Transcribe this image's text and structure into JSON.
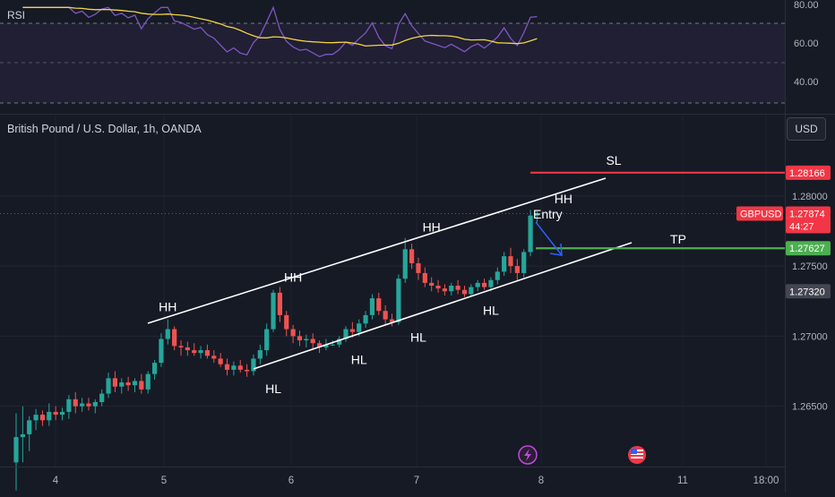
{
  "rsi": {
    "label": "RSI",
    "levels": [
      80,
      60,
      40
    ],
    "tick_labels": [
      "80.00",
      "60.00",
      "40.00"
    ],
    "upper_band": 70,
    "lower_band": 30,
    "colors": {
      "rsi": "#7e57c2",
      "ma": "#f5d442",
      "band_fill": "#2a2540"
    }
  },
  "main": {
    "title": "British Pound / U.S. Dollar, 1h, OANDA",
    "currency_button": "USD"
  },
  "chart_data": {
    "type": "candlestick",
    "symbol": "GBPUSD",
    "x_tick_labels": [
      "4",
      "5",
      "6",
      "7",
      "8",
      "11",
      "18:00"
    ],
    "y_tick_labels": [
      "1.28000",
      "1.27500",
      "1.27000",
      "1.26500"
    ],
    "y_ticks": [
      1.28,
      1.275,
      1.27,
      1.265
    ],
    "ylim": [
      1.2607,
      1.2858
    ],
    "price_tags": [
      {
        "label": "1.28166",
        "value": 1.28166,
        "color": "#f23645"
      },
      {
        "label": "GBPUSD",
        "value": 1.27874,
        "color": "#f23645"
      },
      {
        "label": "1.27874",
        "value": 1.27874,
        "color": "#f23645"
      },
      {
        "label": "44:27",
        "value": 1.27874,
        "color": "#f23645"
      },
      {
        "label": "1.27627",
        "value": 1.27627,
        "color": "#4caf50"
      },
      {
        "label": "1.27320",
        "value": 1.2732,
        "color": "#434651"
      }
    ],
    "annotations": {
      "sl": {
        "label": "SL",
        "value": 1.28166,
        "color": "#f23645"
      },
      "tp": {
        "label": "TP",
        "value": 1.27627,
        "color": "#4caf50"
      },
      "entry": {
        "label": "Entry",
        "color": "#2962ff"
      },
      "swing_labels": [
        {
          "label": "HH",
          "bar": 23,
          "price": 1.2712,
          "pos": "above"
        },
        {
          "label": "HH",
          "bar": 42,
          "price": 1.2733,
          "pos": "above"
        },
        {
          "label": "HH",
          "bar": 63,
          "price": 1.2769,
          "pos": "above"
        },
        {
          "label": "HH",
          "bar": 83,
          "price": 1.2789,
          "pos": "above"
        },
        {
          "label": "HL",
          "bar": 39,
          "price": 1.2672,
          "pos": "below"
        },
        {
          "label": "HL",
          "bar": 52,
          "price": 1.2693,
          "pos": "below"
        },
        {
          "label": "HL",
          "bar": 61,
          "price": 1.2709,
          "pos": "below"
        },
        {
          "label": "HL",
          "bar": 72,
          "price": 1.2728,
          "pos": "below"
        }
      ]
    },
    "candles": [
      [
        1.261,
        1.2645,
        1.259,
        1.2628
      ],
      [
        1.2628,
        1.265,
        1.261,
        1.263
      ],
      [
        1.263,
        1.2643,
        1.2618,
        1.264
      ],
      [
        1.264,
        1.2648,
        1.2633,
        1.2644
      ],
      [
        1.2644,
        1.2647,
        1.2636,
        1.264
      ],
      [
        1.264,
        1.2652,
        1.2636,
        1.2646
      ],
      [
        1.2646,
        1.265,
        1.264,
        1.2644
      ],
      [
        1.2644,
        1.2649,
        1.264,
        1.2646
      ],
      [
        1.2646,
        1.2658,
        1.2641,
        1.2655
      ],
      [
        1.2655,
        1.266,
        1.2645,
        1.265
      ],
      [
        1.265,
        1.2656,
        1.2646,
        1.2652
      ],
      [
        1.2652,
        1.2656,
        1.2647,
        1.265
      ],
      [
        1.265,
        1.2655,
        1.2645,
        1.2653
      ],
      [
        1.2653,
        1.2662,
        1.265,
        1.2659
      ],
      [
        1.2659,
        1.2674,
        1.2656,
        1.267
      ],
      [
        1.267,
        1.2675,
        1.266,
        1.2664
      ],
      [
        1.2664,
        1.267,
        1.2659,
        1.2667
      ],
      [
        1.2667,
        1.2671,
        1.2661,
        1.2665
      ],
      [
        1.2665,
        1.267,
        1.266,
        1.2668
      ],
      [
        1.2668,
        1.2673,
        1.2659,
        1.2662
      ],
      [
        1.2662,
        1.2675,
        1.2659,
        1.2673
      ],
      [
        1.2673,
        1.2683,
        1.2669,
        1.2681
      ],
      [
        1.2681,
        1.2702,
        1.2678,
        1.2698
      ],
      [
        1.2698,
        1.2712,
        1.2694,
        1.2705
      ],
      [
        1.2705,
        1.2707,
        1.269,
        1.2693
      ],
      [
        1.2693,
        1.2697,
        1.2686,
        1.2692
      ],
      [
        1.2692,
        1.2696,
        1.2686,
        1.269
      ],
      [
        1.269,
        1.2695,
        1.2686,
        1.2688
      ],
      [
        1.2688,
        1.2693,
        1.2684,
        1.269
      ],
      [
        1.269,
        1.2694,
        1.2684,
        1.2686
      ],
      [
        1.2686,
        1.269,
        1.2681,
        1.2684
      ],
      [
        1.2684,
        1.2688,
        1.2678,
        1.268
      ],
      [
        1.268,
        1.2684,
        1.2672,
        1.2676
      ],
      [
        1.2676,
        1.2682,
        1.2672,
        1.2679
      ],
      [
        1.2679,
        1.2683,
        1.2674,
        1.2676
      ],
      [
        1.2676,
        1.268,
        1.2671,
        1.2675
      ],
      [
        1.2675,
        1.2687,
        1.2672,
        1.2684
      ],
      [
        1.2684,
        1.2694,
        1.268,
        1.269
      ],
      [
        1.269,
        1.2709,
        1.2686,
        1.2705
      ],
      [
        1.2705,
        1.2733,
        1.2703,
        1.2731
      ],
      [
        1.2731,
        1.2735,
        1.271,
        1.2715
      ],
      [
        1.2715,
        1.2718,
        1.27,
        1.2705
      ],
      [
        1.2705,
        1.2708,
        1.2695,
        1.27
      ],
      [
        1.27,
        1.2704,
        1.2693,
        1.2697
      ],
      [
        1.2697,
        1.2701,
        1.2692,
        1.2698
      ],
      [
        1.2698,
        1.2702,
        1.2691,
        1.2695
      ],
      [
        1.2695,
        1.2697,
        1.2688,
        1.2692
      ],
      [
        1.2692,
        1.2698,
        1.269,
        1.2694
      ],
      [
        1.2694,
        1.2697,
        1.2693,
        1.2694
      ],
      [
        1.2694,
        1.27,
        1.2692,
        1.2698
      ],
      [
        1.2698,
        1.2707,
        1.2696,
        1.2705
      ],
      [
        1.2705,
        1.271,
        1.2699,
        1.2703
      ],
      [
        1.2703,
        1.2712,
        1.27,
        1.2709
      ],
      [
        1.2709,
        1.2718,
        1.2706,
        1.2715
      ],
      [
        1.2715,
        1.273,
        1.2712,
        1.2727
      ],
      [
        1.2727,
        1.2731,
        1.2715,
        1.2718
      ],
      [
        1.2718,
        1.2722,
        1.2708,
        1.2712
      ],
      [
        1.2712,
        1.2716,
        1.2707,
        1.271
      ],
      [
        1.271,
        1.2744,
        1.2708,
        1.2741
      ],
      [
        1.2741,
        1.277,
        1.2738,
        1.2762
      ],
      [
        1.2762,
        1.2766,
        1.2748,
        1.2752
      ],
      [
        1.2752,
        1.2756,
        1.274,
        1.2745
      ],
      [
        1.2745,
        1.2749,
        1.2735,
        1.2738
      ],
      [
        1.2738,
        1.2742,
        1.2732,
        1.2736
      ],
      [
        1.2736,
        1.274,
        1.2731,
        1.2734
      ],
      [
        1.2734,
        1.2737,
        1.2729,
        1.2732
      ],
      [
        1.2732,
        1.2738,
        1.2729,
        1.2736
      ],
      [
        1.2736,
        1.274,
        1.273,
        1.2733
      ],
      [
        1.2733,
        1.2736,
        1.2728,
        1.273
      ],
      [
        1.273,
        1.2737,
        1.2728,
        1.2735
      ],
      [
        1.2735,
        1.274,
        1.2732,
        1.2738
      ],
      [
        1.2738,
        1.2741,
        1.2733,
        1.2735
      ],
      [
        1.2735,
        1.2742,
        1.2732,
        1.274
      ],
      [
        1.274,
        1.2749,
        1.2737,
        1.2746
      ],
      [
        1.2746,
        1.276,
        1.2743,
        1.2757
      ],
      [
        1.2757,
        1.2763,
        1.2745,
        1.275
      ],
      [
        1.275,
        1.2755,
        1.274,
        1.2745
      ],
      [
        1.2745,
        1.2762,
        1.2742,
        1.276
      ],
      [
        1.276,
        1.279,
        1.2757,
        1.2786
      ],
      [
        1.2786,
        1.2789,
        1.2781,
        1.2787
      ]
    ]
  },
  "time_axis": {
    "icons": [
      "lightning-event-icon",
      "us-flag-event-icon"
    ]
  }
}
